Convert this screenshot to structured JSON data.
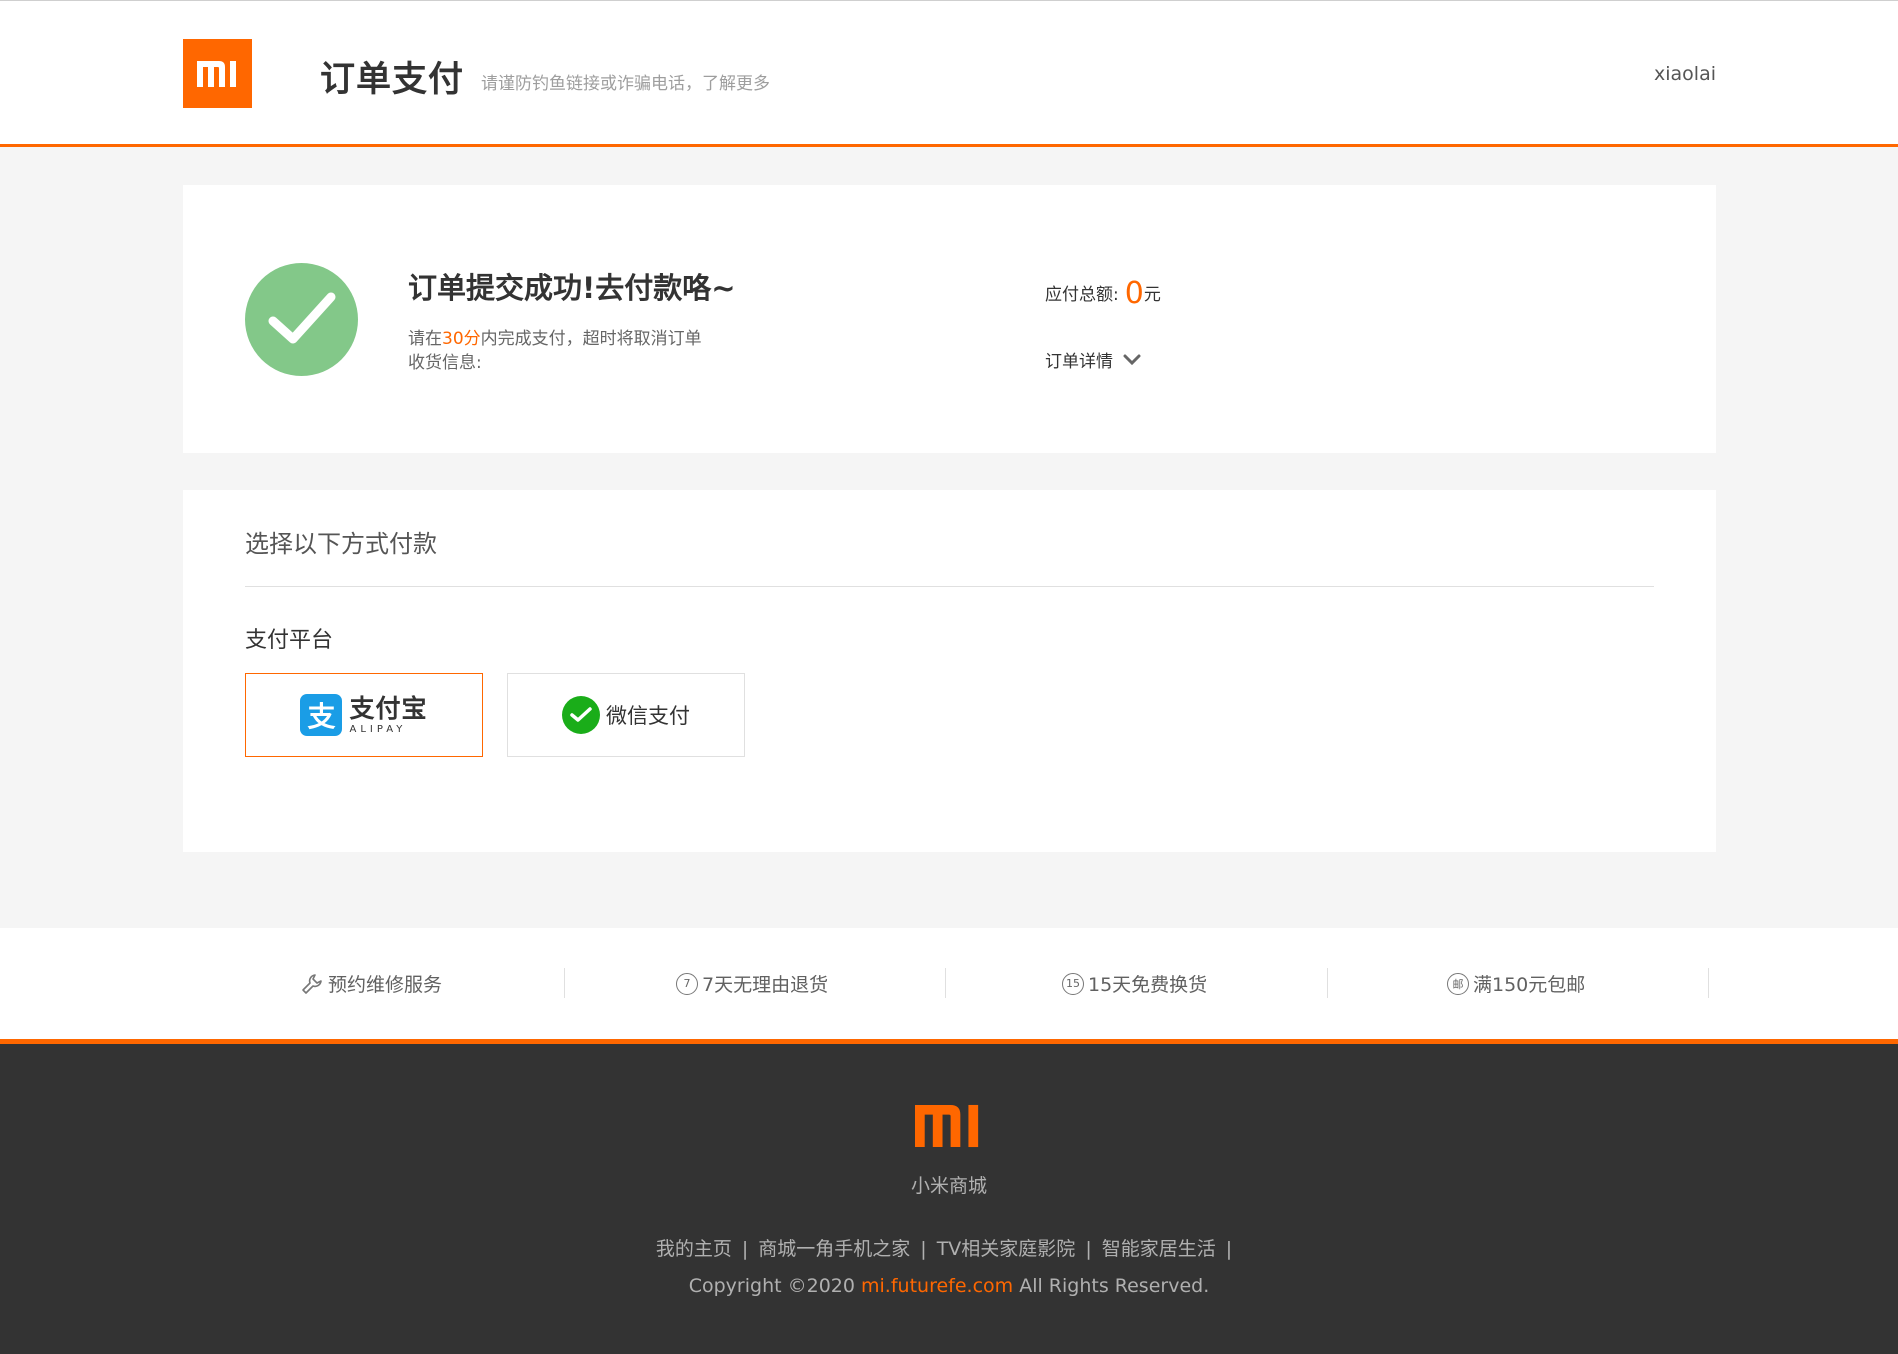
{
  "header": {
    "logo_text": "mi",
    "title": "订单支付",
    "tip": "请谨防钓鱼链接或诈骗电话，了解更多",
    "username": "xiaolai"
  },
  "order": {
    "title": "订单提交成功!去付款咯~",
    "pay_prefix": "请在",
    "pay_minutes": "30分",
    "pay_suffix": "内完成支付，超时将取消订单",
    "address_label": "收货信息:",
    "amount_label": "应付总额:",
    "amount_value": "0",
    "amount_unit": "元",
    "detail_label": "订单详情"
  },
  "payment": {
    "title": "选择以下方式付款",
    "platform_label": "支付平台",
    "options": [
      {
        "cn": "支付宝",
        "en": "ALIPAY",
        "mark": "支",
        "selected": true
      },
      {
        "label": "微信支付",
        "selected": false
      }
    ]
  },
  "services": [
    {
      "icon": "wrench-icon",
      "label": "预约维修服务"
    },
    {
      "icon": "7",
      "label": "7天无理由退货"
    },
    {
      "icon": "15",
      "label": "15天免费换货"
    },
    {
      "icon": "邮",
      "label": "满150元包邮"
    }
  ],
  "footer": {
    "brand": "小米商城",
    "links": [
      "我的主页",
      "商城一角手机之家",
      "TV相关家庭影院",
      "智能家居生活"
    ],
    "link_sep": "|",
    "copyright_prefix": "Copyright ©2020",
    "copyright_site": "mi.futurefe.com",
    "copyright_suffix": "All Rights Reserved."
  },
  "colors": {
    "brand_orange": "#ff6700",
    "success_green": "#83c889",
    "alipay_blue": "#1a9de6",
    "wechat_green": "#1aad19",
    "footer_bg": "#333333"
  }
}
